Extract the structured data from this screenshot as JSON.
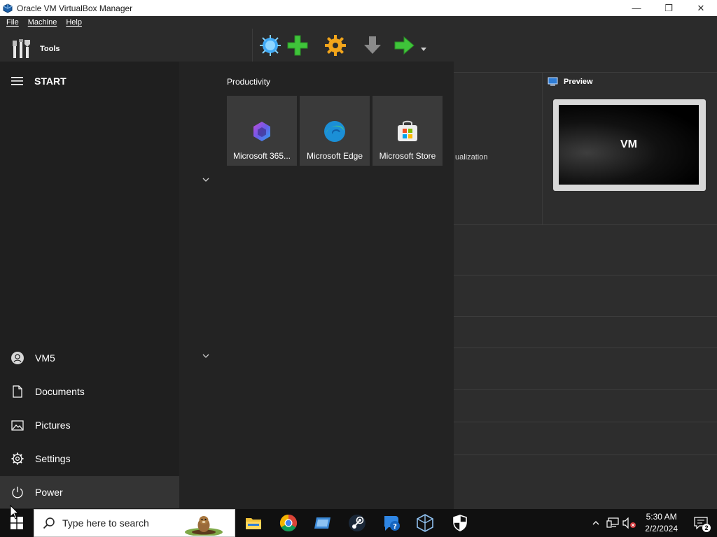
{
  "window": {
    "title": "Oracle VM VirtualBox Manager",
    "controls": {
      "minimize": "—",
      "maximize": "❐",
      "close": "✕"
    }
  },
  "menubar": {
    "items": [
      "File",
      "Machine",
      "Help"
    ]
  },
  "vbox": {
    "tools_label": "Tools",
    "toolbar": [
      {
        "label": "New",
        "icon": "new-starburst-icon"
      },
      {
        "label": "Add",
        "icon": "add-plus-icon"
      },
      {
        "label": "Settings",
        "icon": "settings-gear-icon"
      },
      {
        "label": "Discard",
        "icon": "discard-down-arrow-icon"
      },
      {
        "label": "Start",
        "icon": "start-right-arrow-icon"
      }
    ],
    "preview_title": "Preview",
    "preview_vm_name": "VM",
    "details_fragment": "ualization"
  },
  "start_menu": {
    "title": "START",
    "section_label": "Productivity",
    "tiles": [
      {
        "label": "Microsoft 365...",
        "icon": "microsoft-365-icon"
      },
      {
        "label": "Microsoft Edge",
        "icon": "edge-icon"
      },
      {
        "label": "Microsoft Store",
        "icon": "store-icon"
      }
    ],
    "user": "VM5",
    "items": {
      "documents": "Documents",
      "pictures": "Pictures",
      "settings": "Settings",
      "power": "Power"
    }
  },
  "taskbar": {
    "search_placeholder": "Type here to search",
    "apps": [
      "file-explorer-icon",
      "chrome-icon",
      "remote-desktop-icon",
      "steam-icon",
      "get-help-icon",
      "virtualbox-icon",
      "windows-security-icon"
    ],
    "time": "5:30 AM",
    "date": "2/2/2024",
    "notification_count": "2"
  },
  "colors": {
    "start_left_bg": "#1f1f1f",
    "start_mid_bg": "#232323",
    "tile_bg": "#3a3a3a",
    "taskbar_bg": "#101010",
    "vbox_bg": "#2b2b2b"
  }
}
